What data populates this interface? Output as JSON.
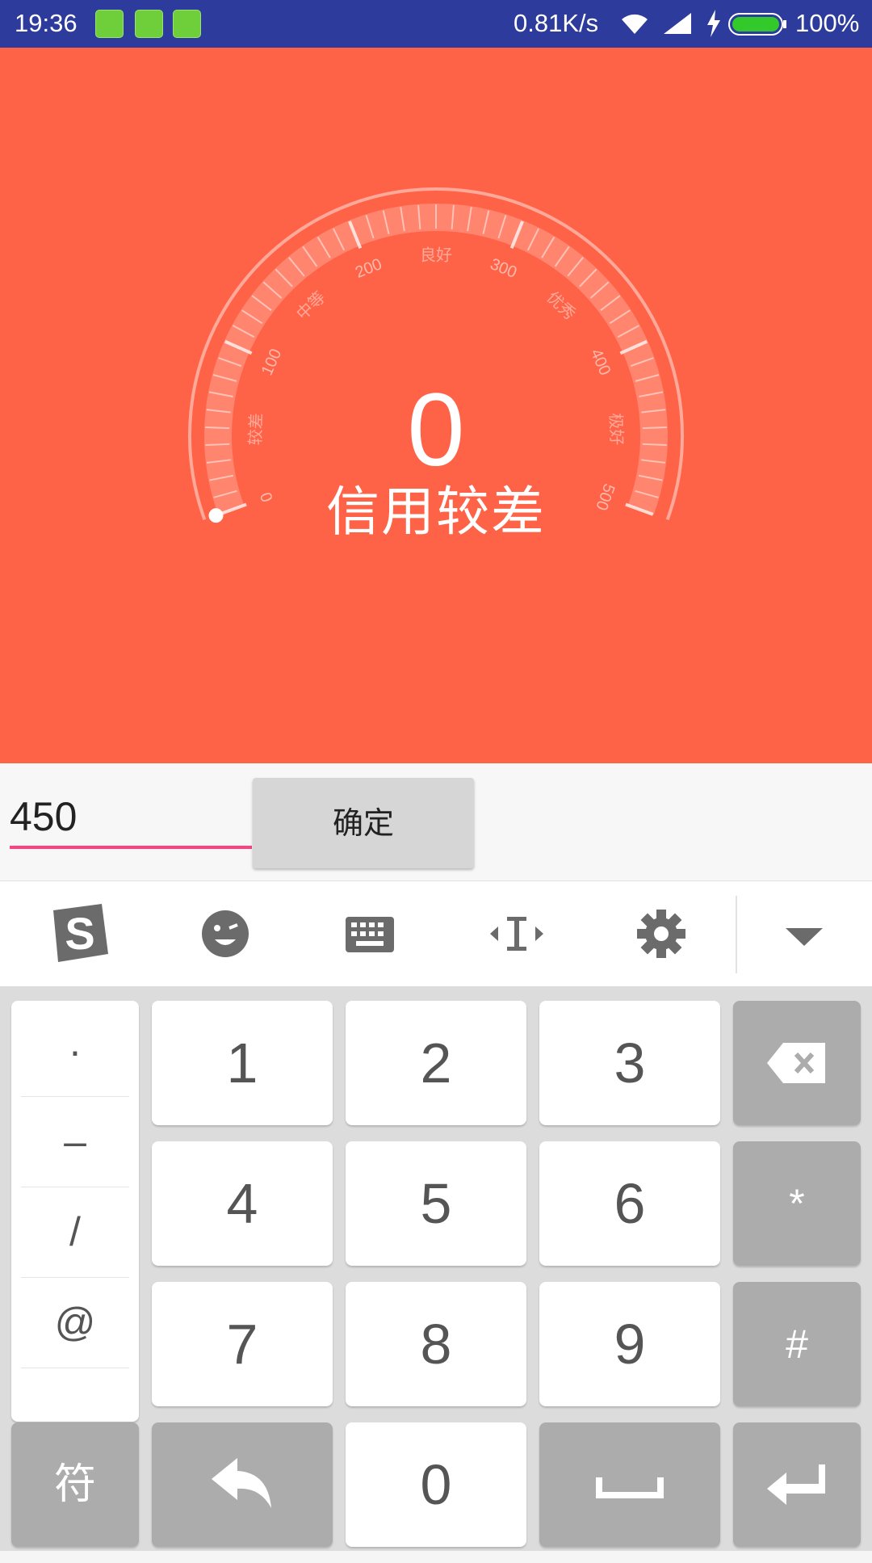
{
  "status_bar": {
    "time": "19:36",
    "net_speed": "0.81K/s",
    "battery_pct": "100%",
    "app_icons": [
      "battery-app-icon",
      "android-app-icon",
      "android-app-icon"
    ]
  },
  "gauge": {
    "score": "0",
    "level_text": "信用较差",
    "scale_numbers": [
      "0",
      "100",
      "200",
      "300",
      "400",
      "500"
    ],
    "scale_labels": [
      "较差",
      "中等",
      "良好",
      "优秀",
      "极好"
    ],
    "colors": {
      "background": "#ff6347",
      "text": "#ffffff"
    }
  },
  "input": {
    "value": "450",
    "confirm_label": "确定",
    "underline_color": "#ff4081"
  },
  "keyboard_toolbar": {
    "icons": [
      "sogou-logo-icon",
      "emoji-icon",
      "keyboard-icon",
      "cursor-move-icon",
      "gear-icon",
      "collapse-down-icon"
    ]
  },
  "keyboard": {
    "symbols": [
      "·",
      "–",
      "/",
      "@"
    ],
    "digits": [
      "1",
      "2",
      "3",
      "4",
      "5",
      "6",
      "7",
      "8",
      "9",
      "0"
    ],
    "star": "*",
    "hash": "#",
    "symbol_key": "符"
  }
}
